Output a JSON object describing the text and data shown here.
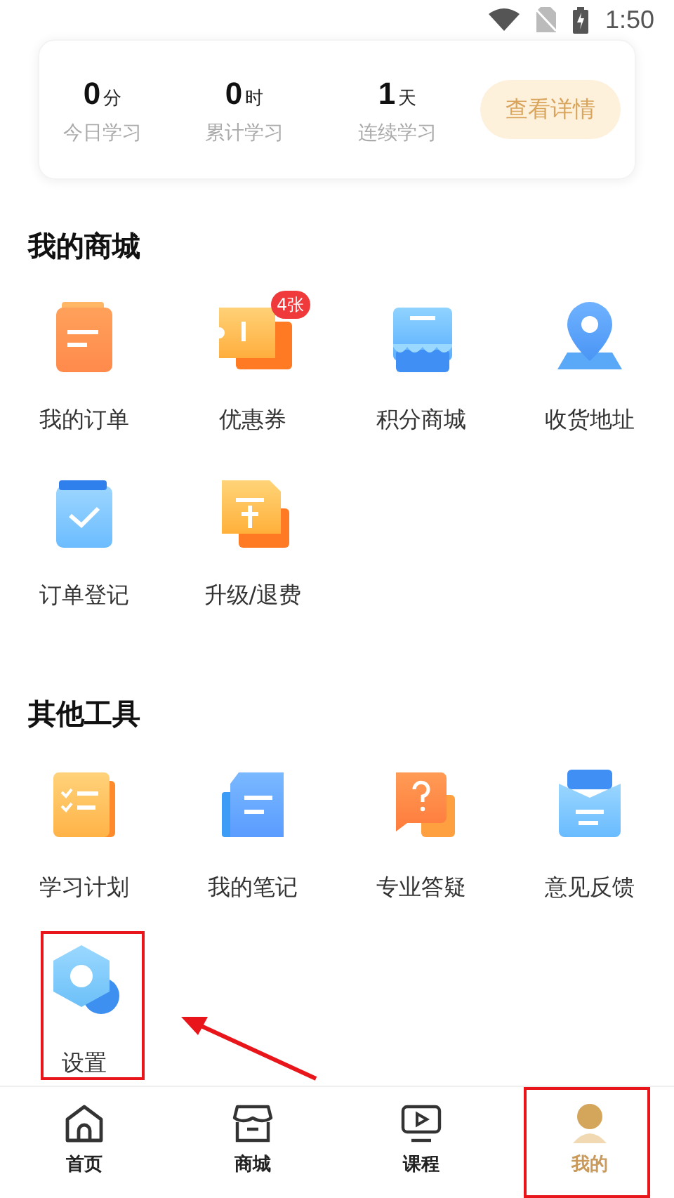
{
  "status_bar": {
    "time": "1:50"
  },
  "stats": [
    {
      "value": "0",
      "unit": "分",
      "label": "今日学习"
    },
    {
      "value": "0",
      "unit": "时",
      "label": "累计学习"
    },
    {
      "value": "1",
      "unit": "天",
      "label": "连续学习"
    }
  ],
  "details_button": "查看详情",
  "sections": [
    {
      "title": "我的商城",
      "items": [
        {
          "label": "我的订单",
          "highlighted": false
        },
        {
          "label": "优惠券",
          "badge": "4张",
          "highlighted": false
        },
        {
          "label": "积分商城",
          "highlighted": false
        },
        {
          "label": "收货地址",
          "highlighted": false
        },
        {
          "label": "订单登记",
          "highlighted": false
        },
        {
          "label": "升级/退费",
          "highlighted": false
        }
      ]
    },
    {
      "title": "其他工具",
      "items": [
        {
          "label": "学习计划",
          "highlighted": false
        },
        {
          "label": "我的笔记",
          "highlighted": false
        },
        {
          "label": "专业答疑",
          "highlighted": false
        },
        {
          "label": "意见反馈",
          "highlighted": false
        },
        {
          "label": "设置",
          "highlighted": true
        }
      ]
    }
  ],
  "tabs": [
    {
      "label": "首页",
      "selected": false,
      "highlighted": false
    },
    {
      "label": "商城",
      "selected": false,
      "highlighted": false
    },
    {
      "label": "课程",
      "selected": false,
      "highlighted": false
    },
    {
      "label": "我的",
      "selected": true,
      "highlighted": true
    }
  ]
}
